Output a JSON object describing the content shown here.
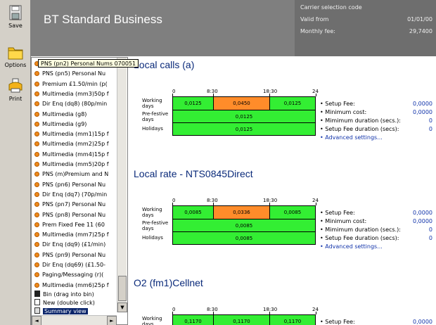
{
  "toolbar": {
    "save": "Save",
    "options": "Options",
    "print": "Print"
  },
  "header": {
    "title": "BT Standard Business",
    "carrier_label": "Carrier selection code",
    "valid_from_label": "Valid from",
    "valid_from_value": "01/01/00",
    "monthly_fee_label": "Monthly fee:",
    "monthly_fee_value": "29,7400"
  },
  "tree": {
    "tooltip": "PNS (pn2) Personal Nums 070051",
    "items": [
      "PNS (pn2) Personal Nu",
      "PNS (pn5) Personal Nu",
      "Premium £1.50/min (p(",
      "Multimedia (mm3)50p f",
      "Dir Enq (dq8) (80p/min",
      "Multimedia (g8)",
      "Multimedia (g9)",
      "Multimedia (mm1)15p f",
      "Multimedia (mm2)25p f",
      "Multimedia (mm4)15p f",
      "Multimedia (mm5)20p f",
      "PNS (m)Premium and N",
      "PNS (pn6) Personal Nu",
      "Dir Enq (dq7) (70p/min",
      "PNS (pn7) Personal Nu",
      "PNS (pn8) Personal Nu",
      "Prem Fixed Fee 11 (60",
      "Multimedia (mm7)25p f",
      "Dir Enq (dq9) (£1/min)",
      "PNS (pn9) Personal Nu",
      "Dir Enq (dq69) (£1.50-",
      "Paging/Messaging (r)(",
      "Multimedia (mm6)25p f"
    ],
    "bin": "Bin (drag into bin)",
    "new": "New (double click)",
    "summary": "Summary view"
  },
  "ticks": {
    "t0": "0",
    "t1": "8:30",
    "t2": "18:30",
    "t3": "24"
  },
  "row_labels": {
    "working": "Working days",
    "prefestive": "Pre-festive days",
    "holidays": "Holidays"
  },
  "settings_labels": {
    "setup_fee": "• Setup Fee:",
    "min_cost": "• Minimum cost:",
    "min_dur": "• Mimimum duration (secs.):",
    "setup_dur": "• Setup Fee duration (secs):",
    "advanced": "• Advanced settings..."
  },
  "sections": [
    {
      "title": "Local calls (a)",
      "working": [
        "0,0125",
        "0,0450",
        "0,0125"
      ],
      "prefestive": "0,0125",
      "holidays": "0,0125",
      "setup_fee": "0,0000",
      "min_cost": "0,0000",
      "min_dur": "0",
      "setup_dur": "0"
    },
    {
      "title": "Local rate - NTS0845Direct",
      "working": [
        "0,0085",
        "0,0336",
        "0,0085"
      ],
      "prefestive": "0,0085",
      "holidays": "0,0085",
      "setup_fee": "0,0000",
      "min_cost": "0,0000",
      "min_dur": "0",
      "setup_dur": "0"
    },
    {
      "title": "O2 (fm1)Cellnet",
      "working": [
        "0,1170",
        "0,1170",
        "0,1170"
      ],
      "setup_fee": "0,0000"
    }
  ]
}
